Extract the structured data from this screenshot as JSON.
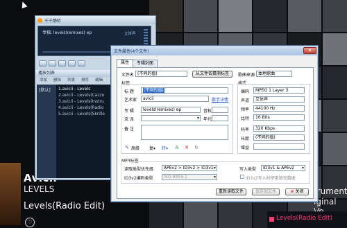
{
  "background": {
    "artist": "Avicii",
    "album": "LEVELS",
    "track": "Levels(Radio Edit)",
    "right_text_1": "trument",
    "right_text_2": "iginal Ve",
    "now_playing": "Levels(Radio Edit)",
    "accent": "#ff3c78",
    "heart_icon": "heart-icon"
  },
  "ttplayer": {
    "title": "千千静听",
    "song": "专辑: levels(remixes) ep",
    "stereo": "立体声",
    "playlist_title": "播放列表",
    "menu": [
      "添加",
      "删除",
      "列表",
      "排序",
      "编辑"
    ],
    "list_name": "[默认]",
    "rows": [
      "1.avicii - Levels",
      "2.avicii - Levels(Cazzo",
      "3.avicii - Levels(Instru",
      "4.avicii - Levels(Radio",
      "5.avicii - Levels(Skrille"
    ]
  },
  "dialog": {
    "title": "文件属性(4个文件)",
    "tabs": [
      "属性",
      "专辑封面"
    ],
    "filename_label": "文件名",
    "filename_value": "(不同的值)",
    "from_filename_btn": "从文件名猜测标签",
    "tag_source_label": "歌曲来源",
    "tag_source_value": "本地歌曲",
    "tag_group_label": "标签",
    "title_label": "标  题",
    "title_value": "(不同的值)",
    "artist_label": "艺术家",
    "artist_value": "avicii",
    "lyrics_link": "歌手详情",
    "album_label": "专  辑",
    "album_value": "levels(remixes) ep",
    "track_label": "音轨",
    "genre_label": "流  派",
    "year_label": "年代",
    "comment_label": "备  注",
    "advanced_btn": "高级",
    "toolbar": [
      "复▾",
      "转▾"
    ],
    "format_group_label": "格式",
    "encoding_label": "编码",
    "encoding_value": "MPEG 1 Layer 3",
    "channel_label": "声道",
    "channel_value": "立体声",
    "samplerate_label": "频率",
    "samplerate_value": "44100 Hz",
    "bitdepth_label": "比特",
    "bitdepth_value": "16 Bits",
    "bitrate_label": "码率",
    "bitrate_value": "320 Kbps",
    "length_label": "长度",
    "length_value": "(不同的值)",
    "gain_label": "增益",
    "mp3tag_group_label": "MP3标签",
    "read_priority_label": "读取类型优先级",
    "read_priority_value": "APEv2 > ID3v2 > ID3v1",
    "write_type_label": "写入类型",
    "write_type_value": "ID3v1 & APEv2",
    "id3_encoding_label": "ID3v2编码类型",
    "id3_encoding_value": "ISO-8859-1",
    "id3_write_check": "ID3v2写入时使用填充数据",
    "reread_btn": "重新读取文件",
    "save_btn": "保存到文件",
    "close_btn": "关闭"
  }
}
